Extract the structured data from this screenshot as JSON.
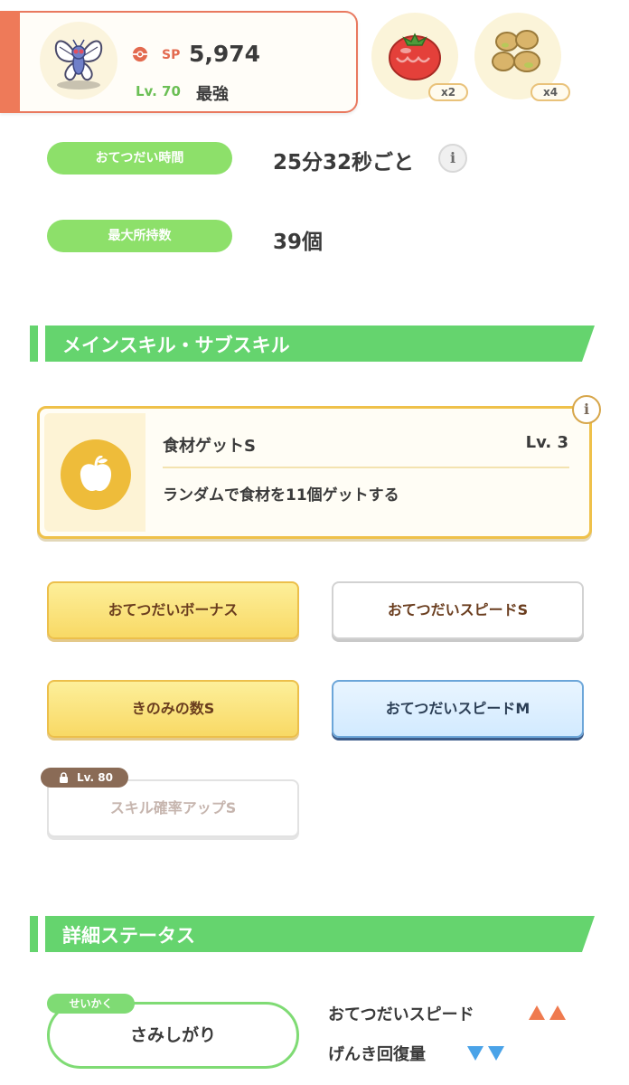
{
  "pokemon": {
    "sp_label": "SP",
    "sp_value": "5,974",
    "level": "Lv. 70",
    "nickname": "最強"
  },
  "ingredients": [
    {
      "icon": "tomato-icon",
      "count": "x2"
    },
    {
      "icon": "soybeans-icon",
      "count": "x4"
    }
  ],
  "stats": [
    {
      "label": "おてつだい時間",
      "value": "25分32秒ごと",
      "has_info": true
    },
    {
      "label": "最大所持数",
      "value": "39個",
      "has_info": false
    }
  ],
  "skills_section": {
    "title": "メインスキル・サブスキル",
    "main_skill": {
      "icon": "apple-icon",
      "name": "食材ゲットS",
      "level": "Lv. 3",
      "description": "ランダムで食材を11個ゲットする"
    },
    "sub_skills": [
      {
        "label": "おてつだいボーナス",
        "style": "gold",
        "locked": false
      },
      {
        "label": "おてつだいスピードS",
        "style": "white",
        "locked": false
      },
      {
        "label": "きのみの数S",
        "style": "gold",
        "locked": false
      },
      {
        "label": "おてつだいスピードM",
        "style": "blue",
        "locked": false
      },
      {
        "label": "スキル確率アップS",
        "style": "locked",
        "locked": true,
        "unlock_level": "Lv. 80"
      }
    ]
  },
  "details_section": {
    "title": "詳細ステータス",
    "nature_tag": "せいかく",
    "nature": "さみしがり",
    "effects": [
      {
        "label": "おてつだいスピード",
        "direction": "up",
        "arrows": 2,
        "color": "#ef7a4e"
      },
      {
        "label": "げんき回復量",
        "direction": "down",
        "arrows": 2,
        "color": "#4aa3e8"
      }
    ]
  },
  "colors": {
    "accent_green": "#65d46e",
    "card_orange": "#ee7a59",
    "skill_gold": "#efc14a"
  }
}
